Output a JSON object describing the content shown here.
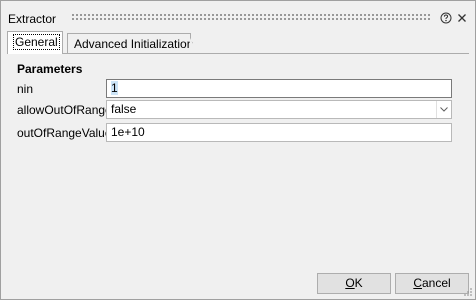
{
  "window": {
    "title": "Extractor"
  },
  "tabs": [
    {
      "label": "General",
      "active": true
    },
    {
      "label": "Advanced Initialization",
      "active": false
    }
  ],
  "parameters": {
    "section_title": "Parameters",
    "fields": [
      {
        "label": "nin",
        "value": "1",
        "type": "text"
      },
      {
        "label": "allowOutOfRange",
        "value": "false",
        "type": "select"
      },
      {
        "label": "outOfRangeValue",
        "value": "1e+10",
        "type": "text"
      }
    ]
  },
  "buttons": {
    "ok_mnemonic": "O",
    "ok_rest": "K",
    "cancel_mnemonic": "C",
    "cancel_rest": "ancel"
  },
  "icons": {
    "help": "help-icon",
    "close": "close-icon",
    "dropdown": "chevron-down-icon"
  }
}
